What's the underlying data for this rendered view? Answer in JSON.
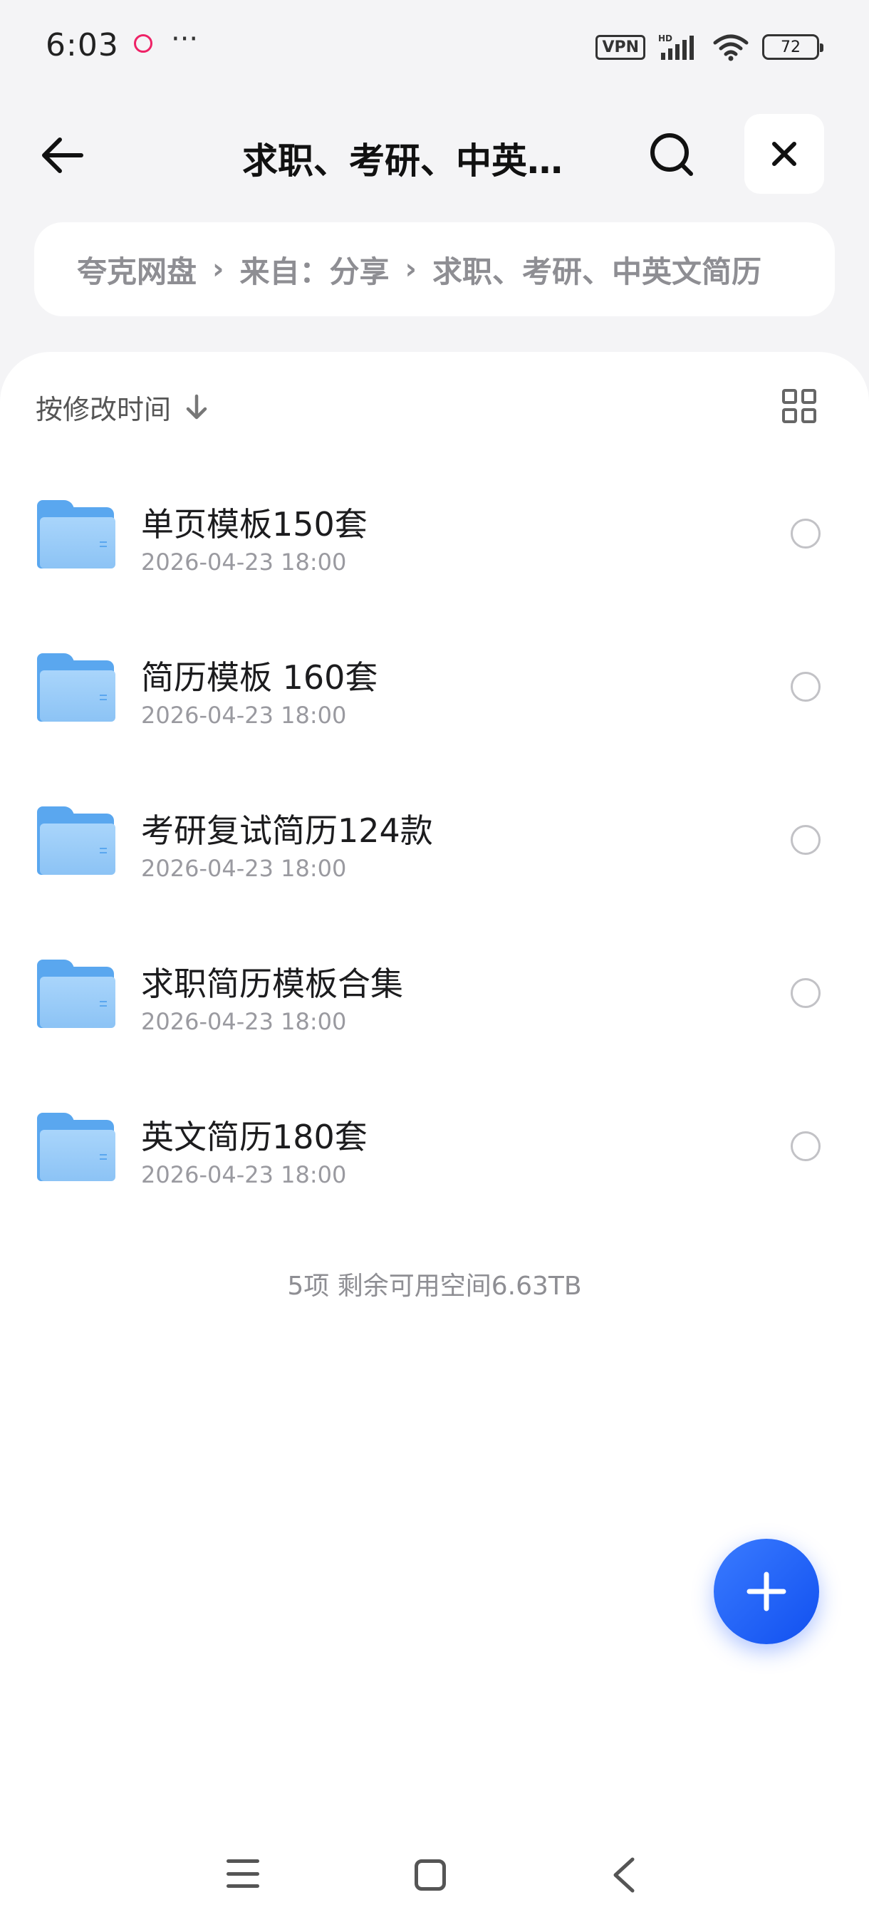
{
  "status_bar": {
    "time": "6:03",
    "more": "···",
    "vpn": "VPN",
    "network": "HD",
    "battery": "72"
  },
  "header": {
    "title": "求职、考研、中英…"
  },
  "breadcrumb": {
    "items": [
      "夸克网盘",
      "来自：分享",
      "求职、考研、中英文简历"
    ]
  },
  "sort": {
    "label": "按修改时间"
  },
  "files": [
    {
      "name": "单页模板150套",
      "date": "2026-04-23 18:00"
    },
    {
      "name": "简历模板 160套",
      "date": "2026-04-23 18:00"
    },
    {
      "name": "考研复试简历124款",
      "date": "2026-04-23 18:00"
    },
    {
      "name": "求职简历模板合集",
      "date": "2026-04-23 18:00"
    },
    {
      "name": "英文简历180套",
      "date": "2026-04-23 18:00"
    }
  ],
  "summary": "5项 剩余可用空间6.63TB",
  "colors": {
    "accent": "#1f5cff",
    "folder": "#5aa7ef",
    "background": "#f4f4f6"
  }
}
